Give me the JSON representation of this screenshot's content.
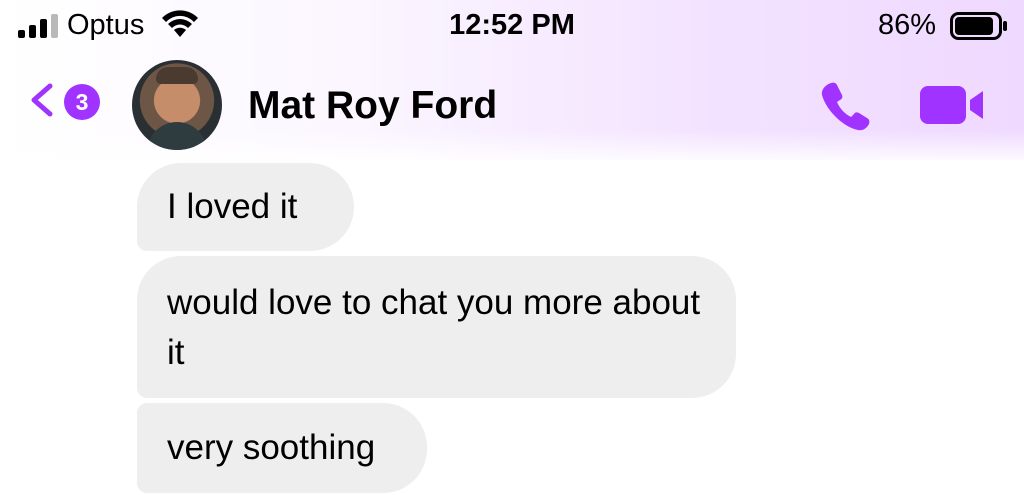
{
  "status_bar": {
    "carrier": "Optus",
    "time": "12:52 PM",
    "battery_percent": "86%",
    "icons": [
      "signal-icon",
      "wifi-icon",
      "battery-icon"
    ]
  },
  "header": {
    "back_icon": "chevron-left-icon",
    "unread_count": "3",
    "contact_name": "Mat Roy Ford",
    "actions": [
      "phone-icon",
      "video-camera-icon"
    ],
    "accent_color": "#a033ff"
  },
  "messages": [
    {
      "text": "I loved it"
    },
    {
      "text": "would love to chat you more about it"
    },
    {
      "text": "very soothing"
    }
  ],
  "colors": {
    "bubble_bg": "#eeeeef",
    "header_gradient_end": "#efd9ff"
  }
}
